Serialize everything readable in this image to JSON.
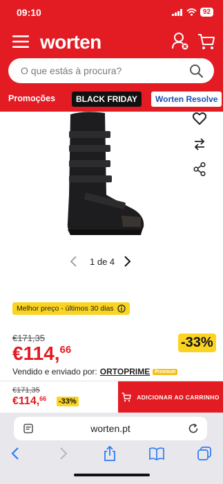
{
  "status": {
    "time": "09:10",
    "battery": "92"
  },
  "header": {
    "logo": "worten",
    "search_placeholder": "O que estás à procura?",
    "chips": {
      "promo": "Promoções",
      "black_friday": "BLACK FRIDAY",
      "resolve": "Worten Resolve"
    }
  },
  "gallery": {
    "pager": "1 de 4"
  },
  "price": {
    "best_price_label": "Melhor preço - últimos 30 dias",
    "old": "€171,35",
    "int": "€114,",
    "dec": "66",
    "discount": "-33%",
    "seller_prefix": "Vendido e enviado por:",
    "seller_name": "ORTOPRIME",
    "seller_badge": "Premium"
  },
  "sticky": {
    "old": "€171,35",
    "int": "€114,",
    "dec": "66",
    "discount": "-33%",
    "add_to_cart": "ADICIONAR AO CARRINHO"
  },
  "browser": {
    "url": "worten.pt"
  },
  "colors": {
    "brand": "#e31b23",
    "badge": "#fbd321",
    "link": "#1b4fb3"
  }
}
